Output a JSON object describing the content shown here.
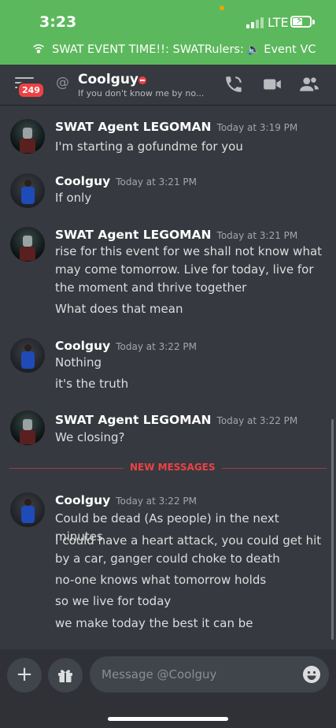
{
  "status_bar": {
    "time": "3:23",
    "network": "LTE",
    "voice_channel_text": "SWAT EVENT TIME!!: SWATRulers:",
    "voice_channel_name": "Event VC"
  },
  "header": {
    "unread_badge": "249",
    "at_symbol": "@",
    "username": "Coolguy",
    "custom_status": "If you don't know me by no..."
  },
  "messages": [
    {
      "author": "SWAT Agent LEGOMAN",
      "timestamp": "Today at 3:19 PM",
      "lines": [
        "I'm starting a gofundme for you"
      ]
    },
    {
      "author": "Coolguy",
      "timestamp": "Today at 3:21 PM",
      "lines": [
        "If only"
      ]
    },
    {
      "author": "SWAT Agent LEGOMAN",
      "timestamp": "Today at 3:21 PM",
      "lines": [
        "rise for this event for we shall not know what may come tomorrow. Live for today, live for the moment and thrive together",
        "What does that mean"
      ]
    },
    {
      "author": "Coolguy",
      "timestamp": "Today at 3:22 PM",
      "lines": [
        "Nothing",
        "it's the truth"
      ]
    },
    {
      "author": "SWAT Agent LEGOMAN",
      "timestamp": "Today at 3:22 PM",
      "lines": [
        "We closing?"
      ]
    },
    {
      "author": "Coolguy",
      "timestamp": "Today at 3:22 PM",
      "lines": [
        "Could be dead (As people) in the next minutes",
        "I could have a heart attack, you could get hit by a car, ganger could choke to death",
        "no-one knows what tomorrow holds",
        "so we live for today",
        "we make today the best it can be"
      ]
    }
  ],
  "new_messages_label": "NEW MESSAGES",
  "composer": {
    "placeholder": "Message @Coolguy"
  },
  "colors": {
    "status_bar_bg": "#5cb85c",
    "chat_bg": "#36393f",
    "accent_red": "#ed4245"
  }
}
